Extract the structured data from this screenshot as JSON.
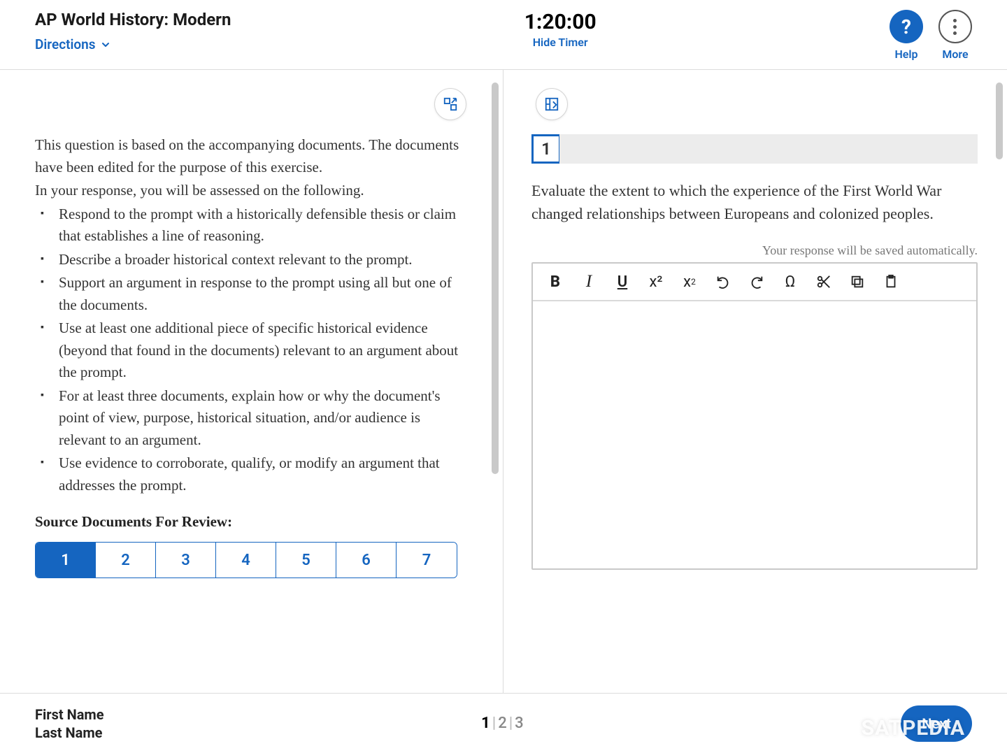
{
  "header": {
    "title": "AP World History: Modern",
    "directions_label": "Directions",
    "timer": "1:20:00",
    "hide_timer_label": "Hide Timer",
    "help_label": "Help",
    "more_label": "More"
  },
  "left": {
    "intro_1": "This question is based on the accompanying documents. The documents have been edited for the purpose of this exercise.",
    "intro_2": "In your response, you will be assessed on the following.",
    "bullets": [
      "Respond to the prompt with a historically defensible thesis or claim that establishes a line of reasoning.",
      "Describe a broader historical context relevant to the prompt.",
      "Support an argument in response to the prompt using all but one of the documents.",
      "Use at least one additional piece of specific historical evidence (beyond that found in the documents) relevant to an argument about the prompt.",
      "For at least three documents, explain how or why the document's point of view, purpose, historical situation, and/or audience is relevant to an argument.",
      "Use evidence to corroborate, qualify, or modify an argument that addresses the prompt."
    ],
    "source_docs_title": "Source Documents For Review:",
    "doc_tabs": [
      "1",
      "2",
      "3",
      "4",
      "5",
      "6",
      "7"
    ],
    "active_tab": "1"
  },
  "right": {
    "question_number": "1",
    "prompt": "Evaluate the extent to which the experience of the First World War changed relationships between Europeans and colonized peoples.",
    "autosave_note": "Your response will be saved automatically.",
    "toolbar": {
      "bold": "B",
      "italic": "I",
      "underline": "U",
      "superscript": "x²",
      "subscript_base": "x",
      "subscript_sub": "2",
      "omega": "Ω",
      "cut": "✂",
      "copy": "⧉",
      "paste": "📋"
    }
  },
  "footer": {
    "first_name": "First Name",
    "last_name": "Last Name",
    "page_current": "1",
    "page_2": "2",
    "page_3": "3",
    "next_label": "Next"
  },
  "watermark": "SATPEDIA"
}
